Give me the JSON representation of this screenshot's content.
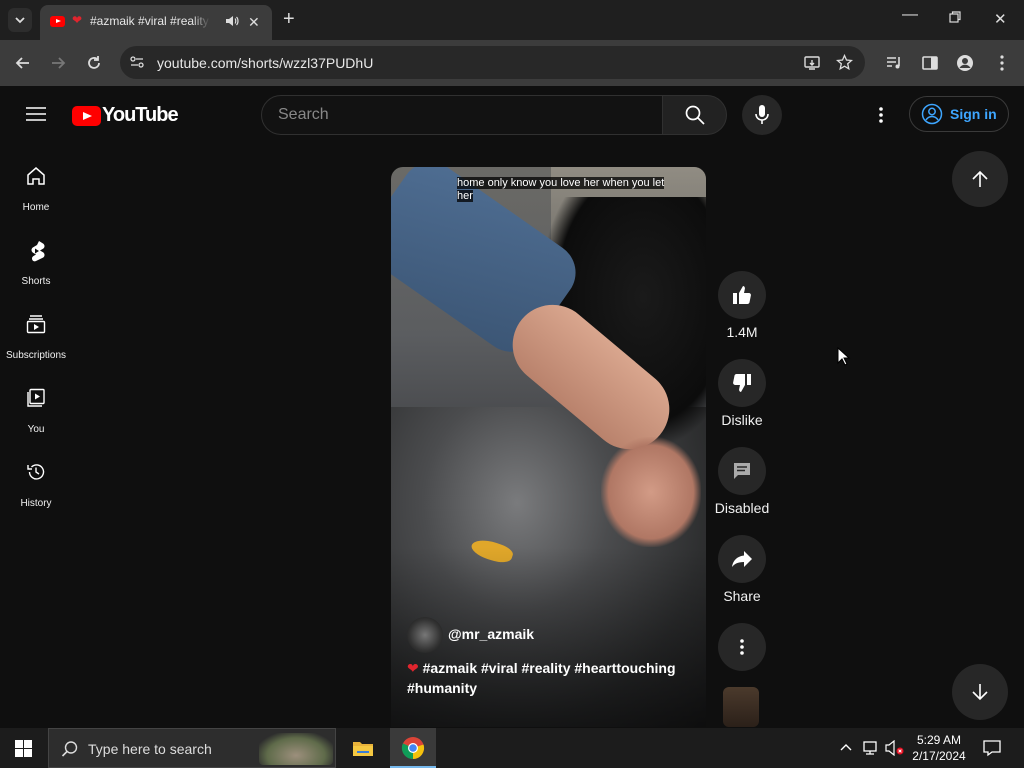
{
  "browser": {
    "tab_title": "#azmaik #viral #reality #hearttouching #humanity",
    "url": "youtube.com/shorts/wzzl37PUDhU"
  },
  "youtube": {
    "logo_text": "YouTube",
    "search_placeholder": "Search",
    "sign_in_label": "Sign in"
  },
  "sidebar": {
    "items": [
      {
        "label": "Home"
      },
      {
        "label": "Shorts"
      },
      {
        "label": "Subscriptions"
      },
      {
        "label": "You"
      },
      {
        "label": "History"
      }
    ]
  },
  "short": {
    "caption": "home only know you love her when you let her",
    "channel": "@mr_azmaik",
    "description": "#azmaik #viral #reality #hearttouching #humanity"
  },
  "actions": {
    "like_count": "1.4M",
    "dislike_label": "Dislike",
    "comments_label": "Disabled",
    "share_label": "Share"
  },
  "taskbar": {
    "search_placeholder": "Type here to search",
    "time": "5:29 AM",
    "date": "2/17/2024"
  },
  "colors": {
    "accent": "#3ea6ff",
    "brand_red": "#ff0000",
    "background": "#0f0f0f"
  }
}
